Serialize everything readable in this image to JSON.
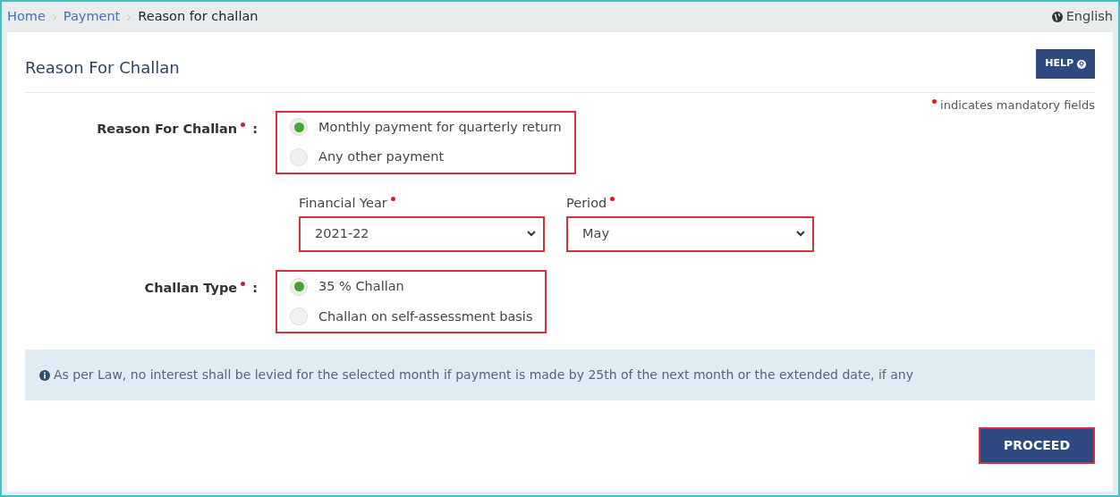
{
  "breadcrumb": [
    {
      "label": "Home",
      "link": true
    },
    {
      "label": "Payment",
      "link": true
    },
    {
      "label": "Reason for challan",
      "link": false
    }
  ],
  "language": "English",
  "card": {
    "title": "Reason For Challan",
    "help_button": "HELP",
    "mandatory_note": "indicates mandatory fields"
  },
  "reason": {
    "label": "Reason For Challan",
    "colon": ":",
    "required": true,
    "highlighted": true,
    "options": [
      {
        "label": "Monthly payment for quarterly return",
        "selected": true
      },
      {
        "label": "Any other payment",
        "selected": false
      }
    ]
  },
  "fields": [
    {
      "label": "Financial Year",
      "required": true,
      "value": "2021-22",
      "highlighted": true
    },
    {
      "label": "Period",
      "required": true,
      "value": "May",
      "highlighted": true
    }
  ],
  "challan_type": {
    "label": "Challan Type",
    "colon": ":",
    "required": true,
    "highlighted": true,
    "options": [
      {
        "label": "35 % Challan",
        "selected": true
      },
      {
        "label": "Challan on self-assessment basis",
        "selected": false
      }
    ]
  },
  "info": "As per Law, no interest shall be levied for the selected month if payment is made by 25th of the next month or the extended date, if any",
  "proceed": {
    "label": "PROCEED",
    "highlighted": true
  }
}
